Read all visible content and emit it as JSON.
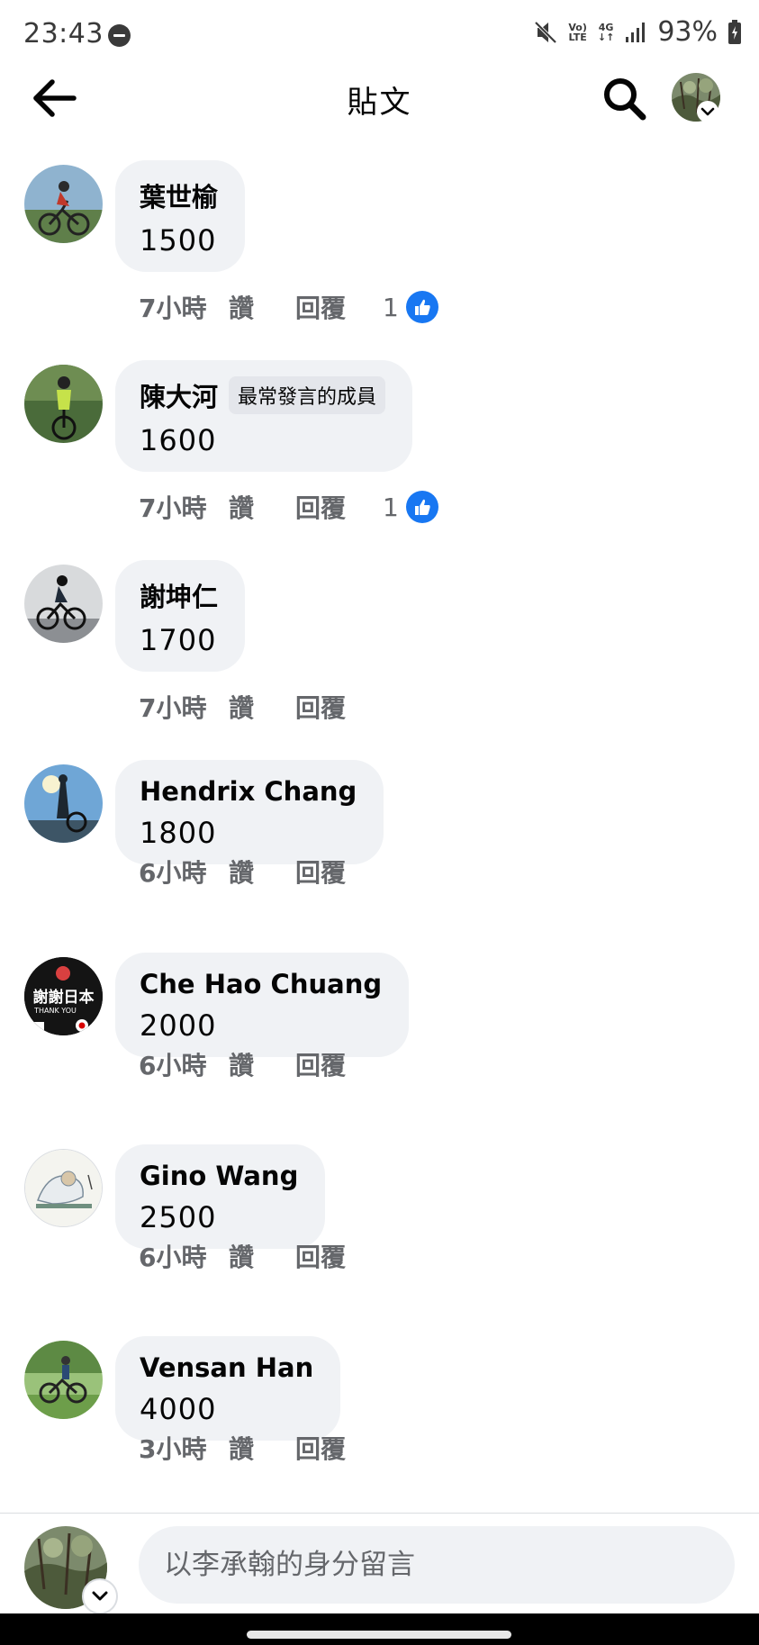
{
  "status_bar": {
    "time": "23:43",
    "battery": "93%",
    "net_volte_top": "Vo)",
    "net_volte_bottom": "LTE",
    "net_4g_top": "4G",
    "net_4g_bottom": "↓↑",
    "icons": [
      "dnd-icon",
      "mute-icon",
      "signal-icon",
      "battery-icon"
    ]
  },
  "header": {
    "title": "貼文",
    "icons": [
      "back-arrow-icon",
      "search-icon",
      "chevron-down-icon"
    ]
  },
  "comments": [
    {
      "name": "葉世榆",
      "text": "1500",
      "time": "7小時",
      "like": "讚",
      "reply": "回覆",
      "reactions": "1",
      "badge": ""
    },
    {
      "name": "陳大河",
      "text": "1600",
      "time": "7小時",
      "like": "讚",
      "reply": "回覆",
      "reactions": "1",
      "badge": "最常發言的成員"
    },
    {
      "name": "謝坤仁",
      "text": "1700",
      "time": "7小時",
      "like": "讚",
      "reply": "回覆",
      "reactions": "",
      "badge": ""
    },
    {
      "name": "Hendrix Chang",
      "text": "1800",
      "time": "6小時",
      "like": "讚",
      "reply": "回覆",
      "reactions": "",
      "badge": ""
    },
    {
      "name": "Che Hao Chuang",
      "text": "2000",
      "time": "6小時",
      "like": "讚",
      "reply": "回覆",
      "reactions": "",
      "badge": ""
    },
    {
      "name": "Gino Wang",
      "text": "2500",
      "time": "6小時",
      "like": "讚",
      "reply": "回覆",
      "reactions": "",
      "badge": ""
    },
    {
      "name": "Vensan Han",
      "text": "4000",
      "time": "3小時",
      "like": "讚",
      "reply": "回覆",
      "reactions": "",
      "badge": ""
    }
  ],
  "avatar_5_logo": {
    "line1": "謝謝日本",
    "line2": "THANK YOU"
  },
  "composer": {
    "placeholder": "以李承翰的身分留言"
  },
  "colors": {
    "bubble": "#f0f2f5",
    "meta_text": "#65676b",
    "like_blue": "#1877f2"
  }
}
